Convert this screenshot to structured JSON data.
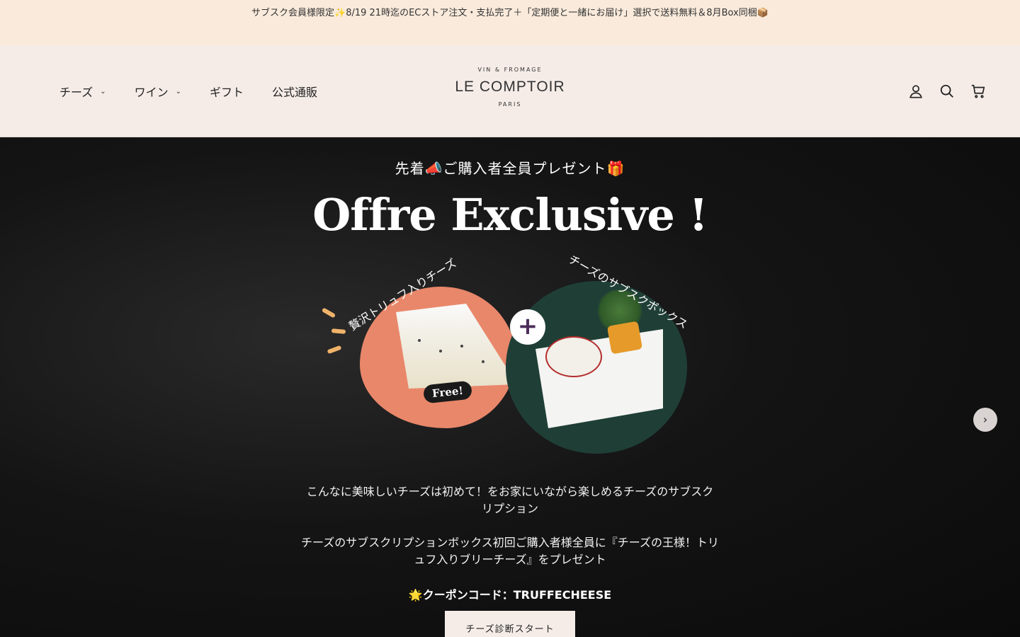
{
  "announcement": {
    "text": "サブスク会員様限定✨8/19 21時迄のECストア注文・支払完了＋「定期便と一緒にお届け」選択で送料無料＆8月Box同梱📦"
  },
  "nav": {
    "items": [
      {
        "label": "チーズ",
        "has_dropdown": true
      },
      {
        "label": "ワイン",
        "has_dropdown": true
      },
      {
        "label": "ギフト",
        "has_dropdown": false
      },
      {
        "label": "公式通販",
        "has_dropdown": false
      }
    ],
    "chevron": "⌄"
  },
  "logo": {
    "top": "VIN & FROMAGE",
    "name": "LE COMPTOIR",
    "bottom": "PARIS"
  },
  "header_icons": [
    "account-icon",
    "search-icon",
    "cart-icon"
  ],
  "hero": {
    "kicker": "先着📣ご購入者全員プレゼント🎁",
    "title": "Offre Exclusive !",
    "label_left": "贅沢トリュフ入りチーズ",
    "label_right": "チーズのサブスクボックス",
    "free_badge": "Free!",
    "plus": "+",
    "desc1": "こんなに美味しいチーズは初めて！をお家にいながら楽しめるチーズのサブスクリプション",
    "desc2": "チーズのサブスクリプションボックス初回ご購入者様全員に『チーズの王様！トリュフ入りブリーチーズ』をプレゼント",
    "coupon": "🌟クーポンコード：TRUFFECHEESE",
    "cta": "チーズ診断スタート ＞",
    "next": "›"
  },
  "colors": {
    "announce_bg": "#f9eadb",
    "header_bg": "#f5ece8",
    "hero_bg": "#111111",
    "accent_orange": "#e9876a",
    "plus_purple": "#4b2d5a"
  }
}
